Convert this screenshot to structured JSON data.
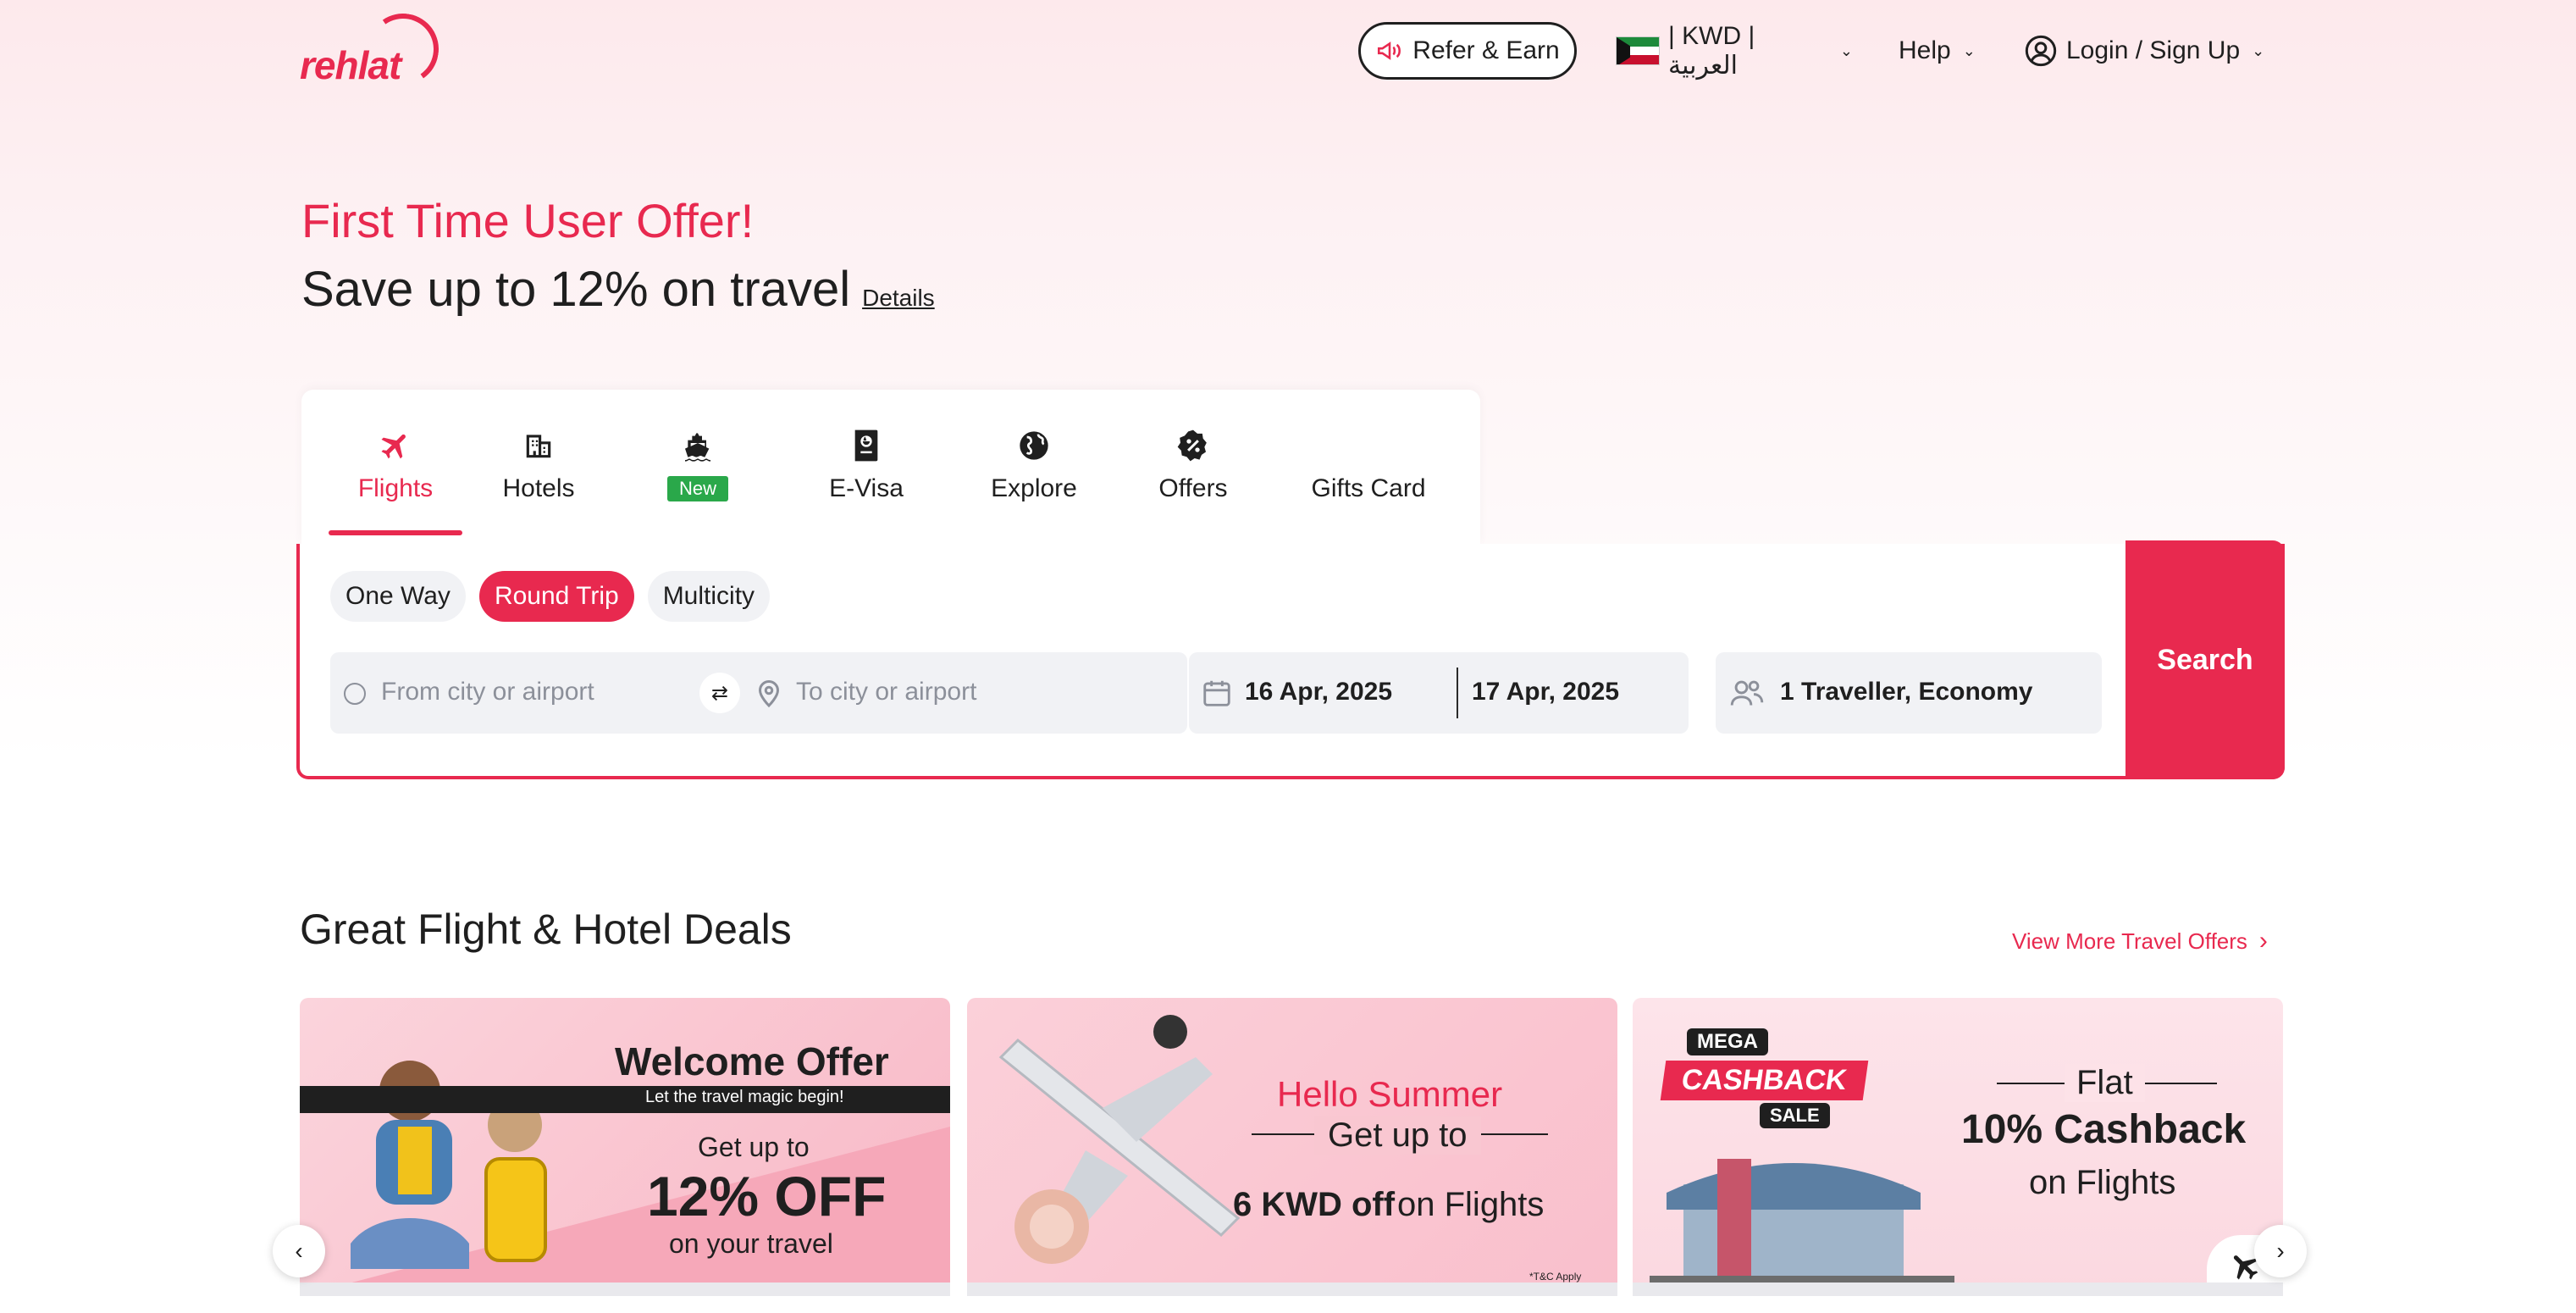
{
  "header": {
    "logo_text": "rehlat",
    "refer_label": "Refer & Earn",
    "currency_label": "| KWD | العربية",
    "help_label": "Help",
    "login_label": "Login / Sign Up"
  },
  "hero": {
    "title": "First Time User Offer!",
    "subtitle": "Save up to 12% on travel",
    "details_link": "Details"
  },
  "tabs": [
    {
      "label": "Flights",
      "icon": "plane-icon",
      "active": true
    },
    {
      "label": "Hotels",
      "icon": "building-icon"
    },
    {
      "label": "New",
      "icon": "cruise-icon",
      "badge": true
    },
    {
      "label": "E-Visa",
      "icon": "passport-icon"
    },
    {
      "label": "Explore",
      "icon": "globe-icon"
    },
    {
      "label": "Offers",
      "icon": "discount-icon"
    },
    {
      "label": "Gifts Card",
      "icon": "gift-card-icon"
    }
  ],
  "search": {
    "trip_types": [
      "One Way",
      "Round Trip",
      "Multicity"
    ],
    "selected_trip": "Round Trip",
    "from_placeholder": "From city or airport",
    "to_placeholder": "To city or airport",
    "depart_date": "16 Apr, 2025",
    "return_date": "17 Apr, 2025",
    "travellers": "1 Traveller, Economy",
    "search_label": "Search"
  },
  "deals": {
    "title": "Great Flight & Hotel Deals",
    "view_more": "View More Travel Offers",
    "cards": [
      {
        "heading": "Welcome Offer",
        "tagline": "Let the travel magic begin!",
        "line1": "Get up to",
        "big": "12% OFF",
        "line2": "on your travel"
      },
      {
        "heading": "Hello Summer",
        "line1": "Get up to",
        "big": "6 KWD off",
        "line2": "on Flights",
        "note": "*T&C Apply"
      },
      {
        "badge_top": "MEGA",
        "badge_main": "CASHBACK",
        "badge_bottom": "SALE",
        "line1": "Flat",
        "big": "10% Cashback",
        "line2": "on Flights"
      }
    ]
  },
  "colors": {
    "brand": "#e8294f",
    "new_badge": "#2aa84a"
  }
}
